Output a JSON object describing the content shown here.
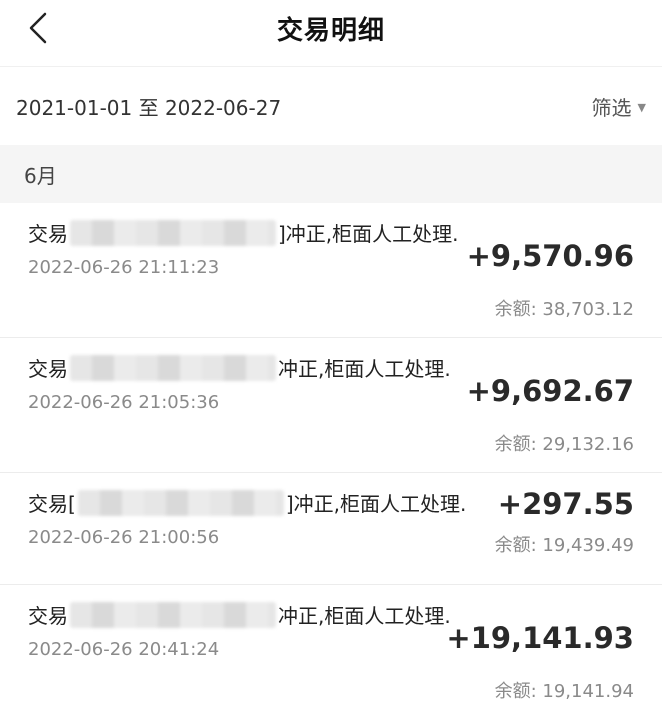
{
  "header": {
    "title": "交易明细",
    "back_icon": "chevron-left-icon"
  },
  "filter": {
    "date_range": "2021-01-01 至 2022-06-27",
    "filter_label": "筛选",
    "filter_arrow": "▼"
  },
  "month": {
    "label": "6月"
  },
  "transactions": [
    {
      "desc_prefix": "交易",
      "desc_suffix": "]冲正,柜面人工处理.",
      "time": "2022-06-26 21:11:23",
      "amount": "+9,570.96",
      "balance_label": "余额:",
      "balance": "38,703.12"
    },
    {
      "desc_prefix": "交易",
      "desc_suffix": "冲正,柜面人工处理.",
      "time": "2022-06-26 21:05:36",
      "amount": "+9,692.67",
      "balance_label": "余额:",
      "balance": "29,132.16"
    },
    {
      "desc_prefix": "交易[",
      "desc_suffix": "]冲正,柜面人工处理.",
      "time": "2022-06-26 21:00:56",
      "amount": "+297.55",
      "balance_label": "余额:",
      "balance": "19,439.49"
    },
    {
      "desc_prefix": "交易",
      "desc_suffix": "冲正,柜面人工处理.",
      "time": "2022-06-26 20:41:24",
      "amount": "+19,141.93",
      "balance_label": "余额:",
      "balance": "19,141.94"
    }
  ]
}
